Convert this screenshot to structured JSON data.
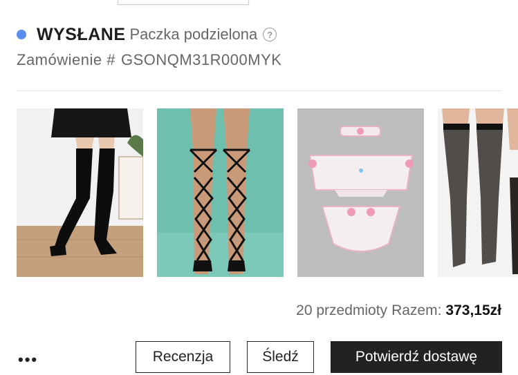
{
  "status": {
    "label": "WYSŁANE",
    "sub": "Paczka podzielona",
    "dot_color": "#5b8def",
    "help_icon": "question-circle-icon"
  },
  "order": {
    "label": "Zamówienie #",
    "number": "GSONQM31R000MYK"
  },
  "products": [
    {
      "name": "thigh-high-socks-black"
    },
    {
      "name": "fishnet-lace-up-socks"
    },
    {
      "name": "pink-bow-lingerie-set"
    },
    {
      "name": "sheer-black-stockings"
    }
  ],
  "summary": {
    "items": "20 przedmioty",
    "total_label": "Razem:",
    "total_value": "373,15zł"
  },
  "actions": {
    "more": "•••",
    "review": "Recenzja",
    "track": "Śledź",
    "confirm": "Potwierdź dostawę"
  }
}
